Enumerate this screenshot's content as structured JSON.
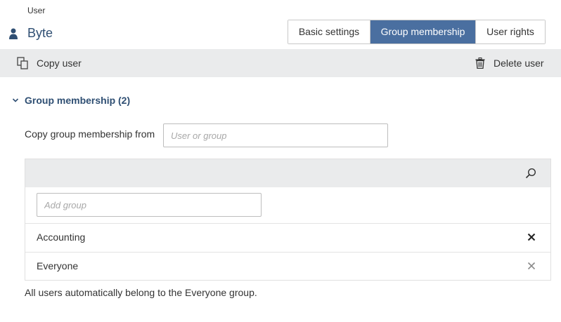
{
  "header": {
    "kind_label": "User",
    "user_name": "Byte",
    "user_icon": "person-icon"
  },
  "tabs": [
    {
      "label": "Basic settings",
      "active": false
    },
    {
      "label": "Group membership",
      "active": true
    },
    {
      "label": "User rights",
      "active": false
    }
  ],
  "toolbar": {
    "copy_label": "Copy user",
    "delete_label": "Delete user"
  },
  "section": {
    "title": "Group membership (2)",
    "expanded": true
  },
  "copy_from": {
    "label": "Copy group membership from",
    "placeholder": "User or group",
    "value": ""
  },
  "groups": {
    "add_placeholder": "Add group",
    "items": [
      {
        "name": "Accounting",
        "removable": true
      },
      {
        "name": "Everyone",
        "removable": false
      }
    ]
  },
  "footnote": "All users automatically belong to the Everyone group.",
  "colors": {
    "accent": "#4a6fa0",
    "title": "#2f4f73",
    "toolbar_bg": "#eaebec"
  }
}
